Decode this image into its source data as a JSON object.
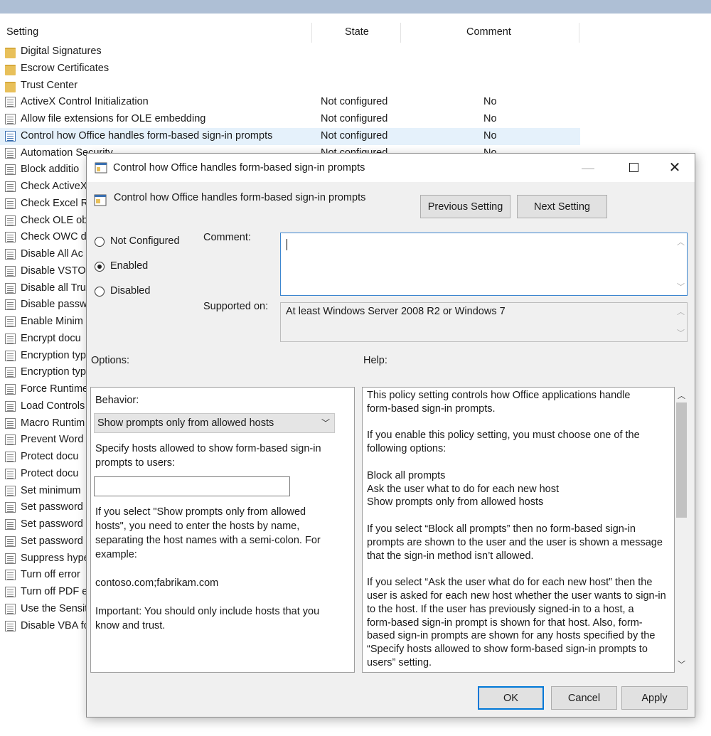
{
  "list": {
    "headers": {
      "setting": "Setting",
      "state": "State",
      "comment": "Comment"
    },
    "rows": [
      {
        "type": "folder",
        "name": "Digital Signatures",
        "state": "",
        "comment": ""
      },
      {
        "type": "folder",
        "name": "Escrow Certificates",
        "state": "",
        "comment": ""
      },
      {
        "type": "folder",
        "name": "Trust Center",
        "state": "",
        "comment": ""
      },
      {
        "type": "policy",
        "name": "ActiveX Control Initialization",
        "state": "Not configured",
        "comment": "No"
      },
      {
        "type": "policy",
        "name": "Allow file extensions for OLE embedding",
        "state": "Not configured",
        "comment": "No"
      },
      {
        "type": "policy",
        "name": "Control how Office handles form-based sign-in prompts",
        "state": "Not configured",
        "comment": "No",
        "selected": true
      },
      {
        "type": "policy",
        "name": "Automation Security",
        "state": "Not configured",
        "comment": "No"
      },
      {
        "type": "policy",
        "name": "Block additio",
        "state": "",
        "comment": ""
      },
      {
        "type": "policy",
        "name": "Check ActiveX",
        "state": "",
        "comment": ""
      },
      {
        "type": "policy",
        "name": "Check Excel R",
        "state": "",
        "comment": ""
      },
      {
        "type": "policy",
        "name": "Check OLE ob",
        "state": "",
        "comment": ""
      },
      {
        "type": "policy",
        "name": "Check OWC d",
        "state": "",
        "comment": ""
      },
      {
        "type": "policy",
        "name": "Disable All Ac",
        "state": "",
        "comment": ""
      },
      {
        "type": "policy",
        "name": "Disable VSTO",
        "state": "",
        "comment": ""
      },
      {
        "type": "policy",
        "name": "Disable all Tru",
        "state": "",
        "comment": ""
      },
      {
        "type": "policy",
        "name": "Disable passw",
        "state": "",
        "comment": ""
      },
      {
        "type": "policy",
        "name": "Enable Minim",
        "state": "",
        "comment": ""
      },
      {
        "type": "policy",
        "name": "Encrypt docu",
        "state": "",
        "comment": ""
      },
      {
        "type": "policy",
        "name": "Encryption typ",
        "state": "",
        "comment": ""
      },
      {
        "type": "policy",
        "name": "Encryption typ",
        "state": "",
        "comment": ""
      },
      {
        "type": "policy",
        "name": "Force Runtime",
        "state": "",
        "comment": ""
      },
      {
        "type": "policy",
        "name": "Load Controls",
        "state": "",
        "comment": ""
      },
      {
        "type": "policy",
        "name": "Macro Runtim",
        "state": "",
        "comment": ""
      },
      {
        "type": "policy",
        "name": "Prevent Word",
        "state": "",
        "comment": ""
      },
      {
        "type": "policy",
        "name": "Protect docu",
        "state": "",
        "comment": ""
      },
      {
        "type": "policy",
        "name": "Protect docu",
        "state": "",
        "comment": ""
      },
      {
        "type": "policy",
        "name": "Set minimum",
        "state": "",
        "comment": ""
      },
      {
        "type": "policy",
        "name": "Set password",
        "state": "",
        "comment": ""
      },
      {
        "type": "policy",
        "name": "Set password",
        "state": "",
        "comment": ""
      },
      {
        "type": "policy",
        "name": "Set password",
        "state": "",
        "comment": ""
      },
      {
        "type": "policy",
        "name": "Suppress hype",
        "state": "",
        "comment": ""
      },
      {
        "type": "policy",
        "name": "Turn off error",
        "state": "",
        "comment": ""
      },
      {
        "type": "policy",
        "name": "Turn off PDF e",
        "state": "",
        "comment": ""
      },
      {
        "type": "policy",
        "name": "Use the Sensit",
        "state": "",
        "comment": ""
      },
      {
        "type": "policy",
        "name": "Disable VBA fo",
        "state": "",
        "comment": ""
      }
    ]
  },
  "dialog": {
    "title": "Control how Office handles form-based sign-in prompts",
    "policy_name": "Control how Office handles form-based sign-in prompts",
    "prev_label": "Previous Setting",
    "next_label": "Next Setting",
    "radios": [
      {
        "label": "Not Configured",
        "checked": false
      },
      {
        "label": "Enabled",
        "checked": true
      },
      {
        "label": "Disabled",
        "checked": false
      }
    ],
    "comment_label": "Comment:",
    "comment_value": "",
    "supported_label": "Supported on:",
    "supported_value": "At least Windows Server 2008 R2 or Windows 7",
    "options_label": "Options:",
    "help_label": "Help:",
    "options": {
      "behavior_label": "Behavior:",
      "behavior_value": "Show prompts only from allowed hosts",
      "hosts_label_1": "Specify hosts allowed to show form-based sign-in",
      "hosts_label_2": "prompts to users:",
      "hosts_value": "",
      "note_1": "If you select \"Show prompts only from allowed",
      "note_2": "hosts\", you need to enter the hosts by name,",
      "note_3": "separating the host names with a semi-colon. For",
      "note_4": "example:",
      "example": "contoso.com;fabrikam.com",
      "important_1": "Important: You should only include hosts that you",
      "important_2": "know and trust."
    },
    "help": {
      "lines": [
        "This policy setting controls how Office applications handle",
        "form-based sign-in prompts.",
        "",
        "If you enable this policy setting, you must choose one of the",
        "following options:",
        "",
        "Block all prompts",
        "Ask the user what to do for each new host",
        "Show prompts only from allowed hosts",
        "",
        "If you select “Block all prompts” then no form-based sign-in",
        "prompts are shown to the user and the user is shown a message",
        "that the sign-in method isn’t allowed.",
        "",
        "If you select “Ask the user what do for each new host” then the",
        "user is asked for each new host whether the user wants to sign-in",
        "to the host. If the user has previously signed-in to a host, a",
        "form-based sign-in prompt is shown for that host. Also, form-",
        "based sign-in prompts are shown for any hosts specified by the",
        "“Specify hosts allowed to show form-based sign-in prompts to",
        "users” setting."
      ]
    },
    "ok_label": "OK",
    "cancel_label": "Cancel",
    "apply_label": "Apply",
    "min_glyph": "—",
    "close_glyph": "✕"
  }
}
